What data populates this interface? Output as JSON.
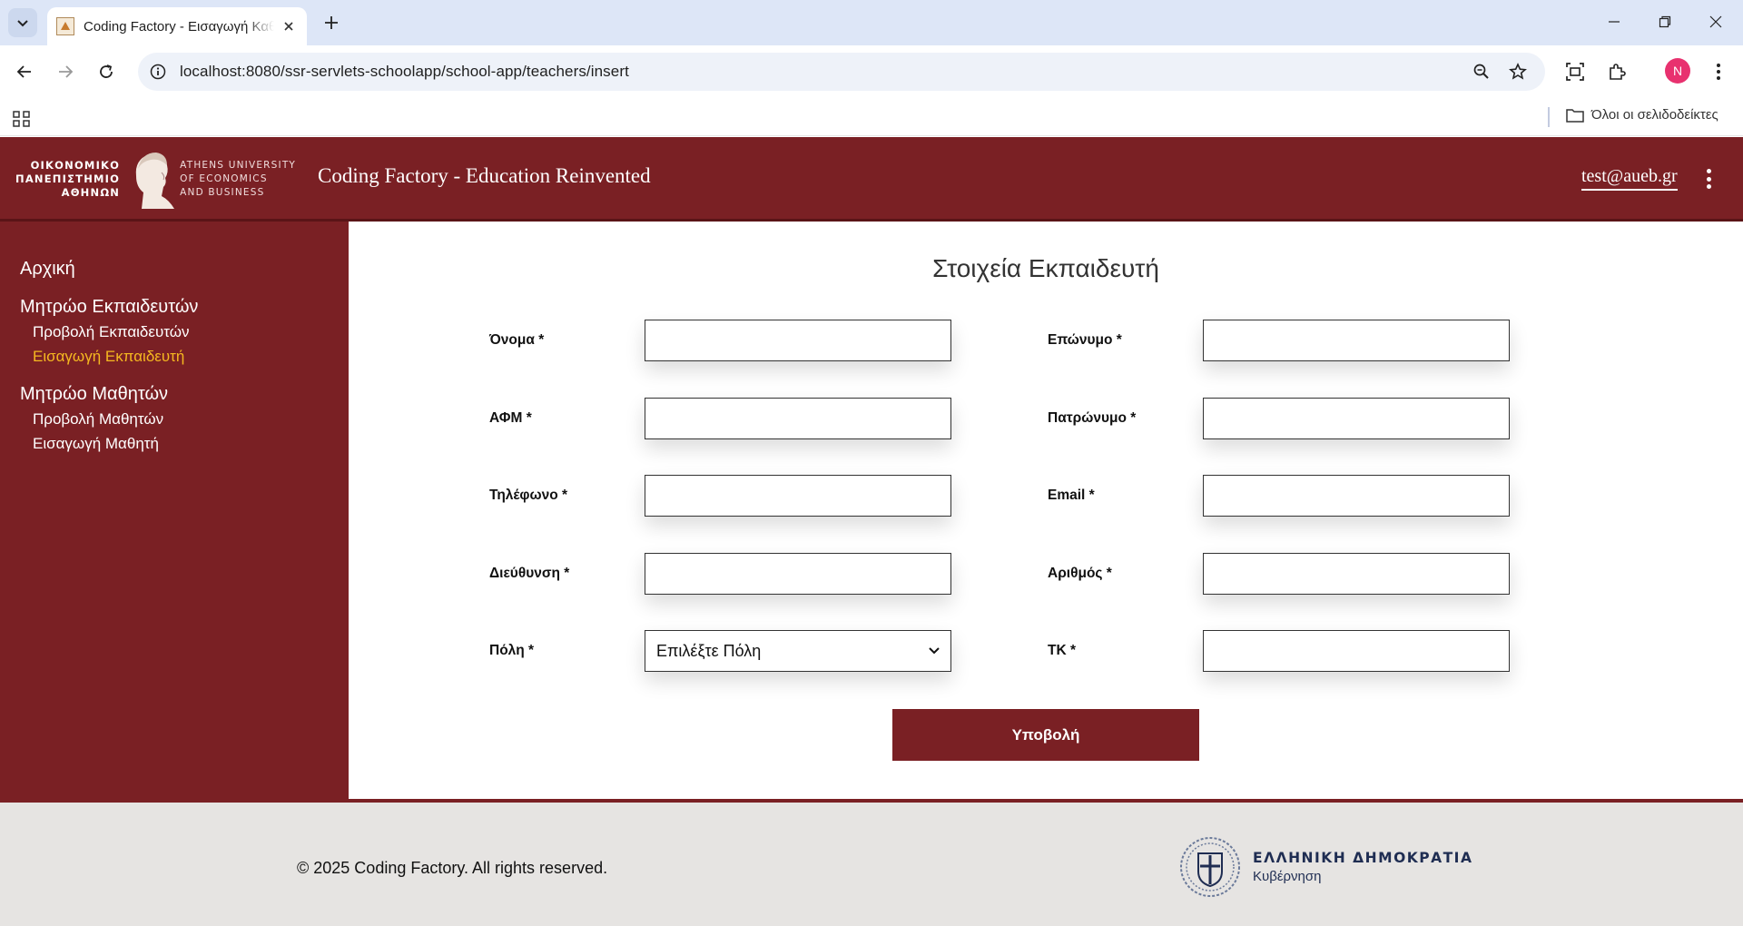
{
  "browser": {
    "tab_title": "Coding Factory - Εισαγωγή Καθηγητή",
    "url": "localhost:8080/ssr-servlets-schoolapp/school-app/teachers/insert",
    "bookmarks_all": "Όλοι οι σελιδοδείκτες",
    "profile_initial": "N",
    "profile_color": "#e8316f"
  },
  "header": {
    "logo_gr_lines": [
      "ΟΙΚΟΝΟΜΙΚΟ",
      "ΠΑΝΕΠΙΣΤΗΜΙΟ",
      "ΑΘΗΝΩΝ"
    ],
    "logo_en_lines": [
      "ATHENS UNIVERSITY",
      "OF ECONOMICS",
      "AND BUSINESS"
    ],
    "title": "Coding Factory - Education Reinvented",
    "user_email": "test@aueb.gr"
  },
  "sidebar": {
    "home": "Αρχική",
    "teachers_group": "Μητρώο Εκπαιδευτών",
    "teachers_view": "Προβολή Εκπαιδευτών",
    "teachers_insert": "Εισαγωγή Εκπαιδευτή",
    "students_group": "Μητρώο Μαθητών",
    "students_view": "Προβολή Μαθητών",
    "students_insert": "Εισαγωγή Μαθητή"
  },
  "form": {
    "title": "Στοιχεία Εκπαιδευτή",
    "firstname_label": "Όνομα *",
    "lastname_label": "Επώνυμο *",
    "vat_label": "ΑΦΜ *",
    "fathername_label": "Πατρώνυμο *",
    "phone_label": "Τηλέφωνο *",
    "email_label": "Email *",
    "street_label": "Διεύθυνση *",
    "street_number_label": "Αριθμός *",
    "city_label": "Πόλη *",
    "city_selected": "Επιλέξτε Πόλη",
    "zipcode_label": "ΤΚ *",
    "submit_label": "Υποβολή"
  },
  "footer": {
    "copyright": "© 2025 Coding Factory. All rights reserved.",
    "gov_title": "ΕΛΛΗΝΙΚΗ ΔΗΜΟΚΡΑΤΙΑ",
    "gov_subtitle": "Κυβέρνηση"
  },
  "colors": {
    "brand": "#7a2024",
    "active_link": "#f5b820",
    "footer_bg": "#e6e4e2"
  }
}
